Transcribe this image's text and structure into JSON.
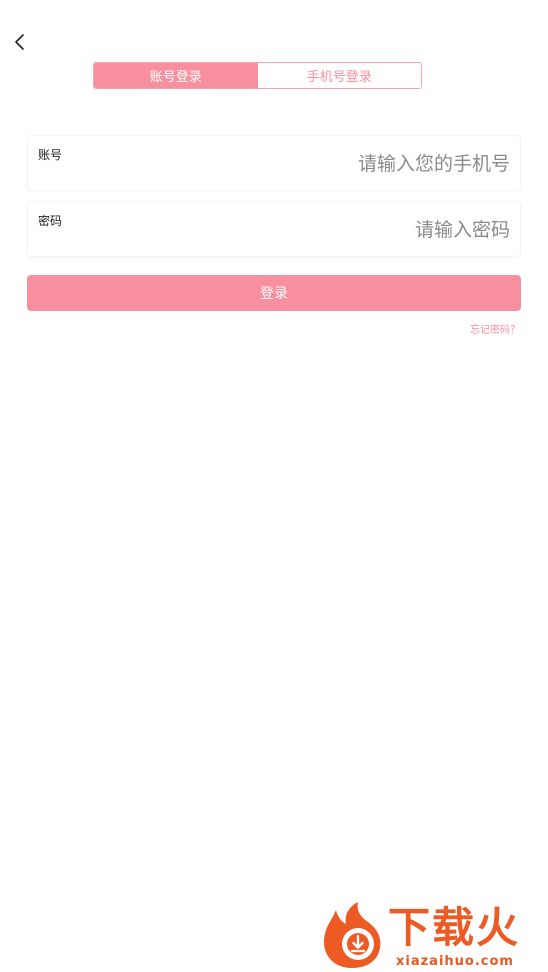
{
  "header": {
    "back_icon": "chevron-left-icon"
  },
  "tabs": [
    {
      "label": "账号登录",
      "active": true
    },
    {
      "label": "手机号登录",
      "active": false
    }
  ],
  "form": {
    "account": {
      "label": "账号",
      "placeholder": "请输入您的手机号",
      "value": ""
    },
    "password": {
      "label": "密码",
      "placeholder": "请输入密码",
      "value": ""
    },
    "submit_label": "登录",
    "forgot_label": "忘记密码？"
  },
  "watermark": {
    "brand": "下载火",
    "domain": "xiazaihuo.com"
  },
  "colors": {
    "accent": "#f78f9e",
    "watermark": "#ee5a24"
  }
}
